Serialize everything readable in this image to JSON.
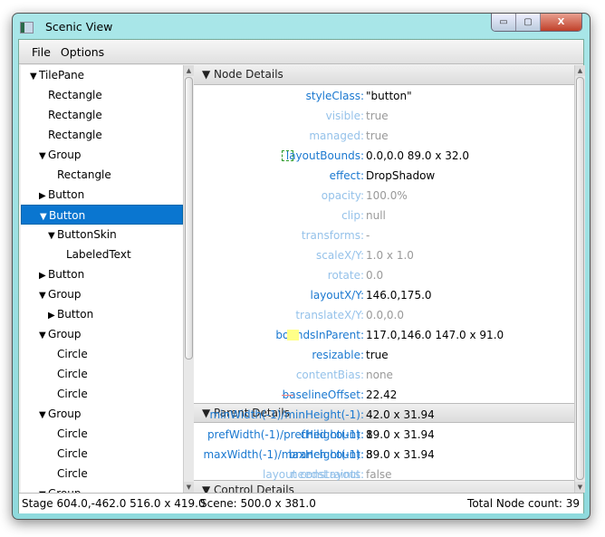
{
  "window": {
    "title": "Scenic View",
    "minimize": "▭",
    "maximize": "▢",
    "close": "X"
  },
  "menu": [
    "File",
    "Options"
  ],
  "tree": [
    {
      "label": "TilePane",
      "level": 0,
      "state": "expanded"
    },
    {
      "label": "Rectangle",
      "level": 1,
      "state": "leaf"
    },
    {
      "label": "Rectangle",
      "level": 1,
      "state": "leaf"
    },
    {
      "label": "Rectangle",
      "level": 1,
      "state": "leaf"
    },
    {
      "label": "Group",
      "level": 1,
      "state": "expanded"
    },
    {
      "label": "Rectangle",
      "level": 2,
      "state": "leaf"
    },
    {
      "label": "Button",
      "level": 1,
      "state": "collapsed"
    },
    {
      "label": "Button",
      "level": 1,
      "state": "expanded",
      "selected": true
    },
    {
      "label": "ButtonSkin",
      "level": 2,
      "state": "expanded"
    },
    {
      "label": "LabeledText",
      "level": 3,
      "state": "leaf"
    },
    {
      "label": "Button",
      "level": 1,
      "state": "collapsed"
    },
    {
      "label": "Group",
      "level": 1,
      "state": "expanded"
    },
    {
      "label": "Button",
      "level": 2,
      "state": "collapsed"
    },
    {
      "label": "Group",
      "level": 1,
      "state": "expanded"
    },
    {
      "label": "Circle",
      "level": 2,
      "state": "leaf"
    },
    {
      "label": "Circle",
      "level": 2,
      "state": "leaf"
    },
    {
      "label": "Circle",
      "level": 2,
      "state": "leaf"
    },
    {
      "label": "Group",
      "level": 1,
      "state": "expanded"
    },
    {
      "label": "Circle",
      "level": 2,
      "state": "leaf"
    },
    {
      "label": "Circle",
      "level": 2,
      "state": "leaf"
    },
    {
      "label": "Circle",
      "level": 2,
      "state": "leaf"
    },
    {
      "label": "Group",
      "level": 1,
      "state": "expanded"
    }
  ],
  "sections": {
    "node": "Node Details",
    "parent": "Parent Details",
    "control": "Control Details"
  },
  "node_details": [
    {
      "label": "styleClass:",
      "value": "\"button\"",
      "active": true
    },
    {
      "label": "visible:",
      "value": "true",
      "active": false
    },
    {
      "label": "managed:",
      "value": "true",
      "active": false
    },
    {
      "label": "layoutBounds:",
      "value": "0.0,0.0  89.0 x 32.0",
      "active": true,
      "swatch": "layout-bounds"
    },
    {
      "label": "effect:",
      "value": "DropShadow",
      "active": true
    },
    {
      "label": "opacity:",
      "value": "100.0%",
      "active": false
    },
    {
      "label": "clip:",
      "value": "null",
      "active": false
    },
    {
      "label": "transforms:",
      "value": "-",
      "active": false
    },
    {
      "label": "scaleX/Y:",
      "value": "1.0 x 1.0",
      "active": false
    },
    {
      "label": "rotate:",
      "value": "0.0",
      "active": false
    },
    {
      "label": "layoutX/Y:",
      "value": "146.0,175.0",
      "active": true
    },
    {
      "label": "translateX/Y:",
      "value": "0.0,0.0",
      "active": false
    },
    {
      "label": "boundsInParent:",
      "value": "117.0,146.0  147.0 x 91.0",
      "active": true,
      "swatch": "bounds-in-parent"
    },
    {
      "label": "resizable:",
      "value": "true",
      "active": true
    },
    {
      "label": "contentBias:",
      "value": "none",
      "active": false
    },
    {
      "label": "baselineOffset:",
      "value": "22.42",
      "active": true,
      "swatch": "baseline"
    },
    {
      "label": "minWidth(-1)/minHeight(-1):",
      "value": "42.0 x 31.94",
      "active": true
    },
    {
      "label": "prefWidth(-1)/prefHeight(-1):",
      "value": "89.0 x 31.94",
      "active": true
    },
    {
      "label": "maxWidth(-1)/maxHeight(-1):",
      "value": "89.0 x 31.94",
      "active": true
    },
    {
      "label": "layout constraints:",
      "value": "",
      "active": false
    }
  ],
  "parent_details": [
    {
      "label": "child count:",
      "value": "1",
      "active": true
    },
    {
      "label": "branch count:",
      "value": "3",
      "active": true
    },
    {
      "label": "needsLayout:",
      "value": "false",
      "active": false
    }
  ],
  "status": {
    "stage": "Stage 604.0,-462.0  516.0 x 419.0",
    "scene": "Scene: 500.0 x 381.0",
    "count": "Total Node count: 39"
  },
  "colors": {
    "selection": "#0a76d0",
    "active_label": "#1a78d0",
    "inactive_label": "#95c2ea",
    "layout_bounds": "#2a9a2a",
    "bounds_in_parent": "#ffff88",
    "baseline": "#f08080"
  }
}
